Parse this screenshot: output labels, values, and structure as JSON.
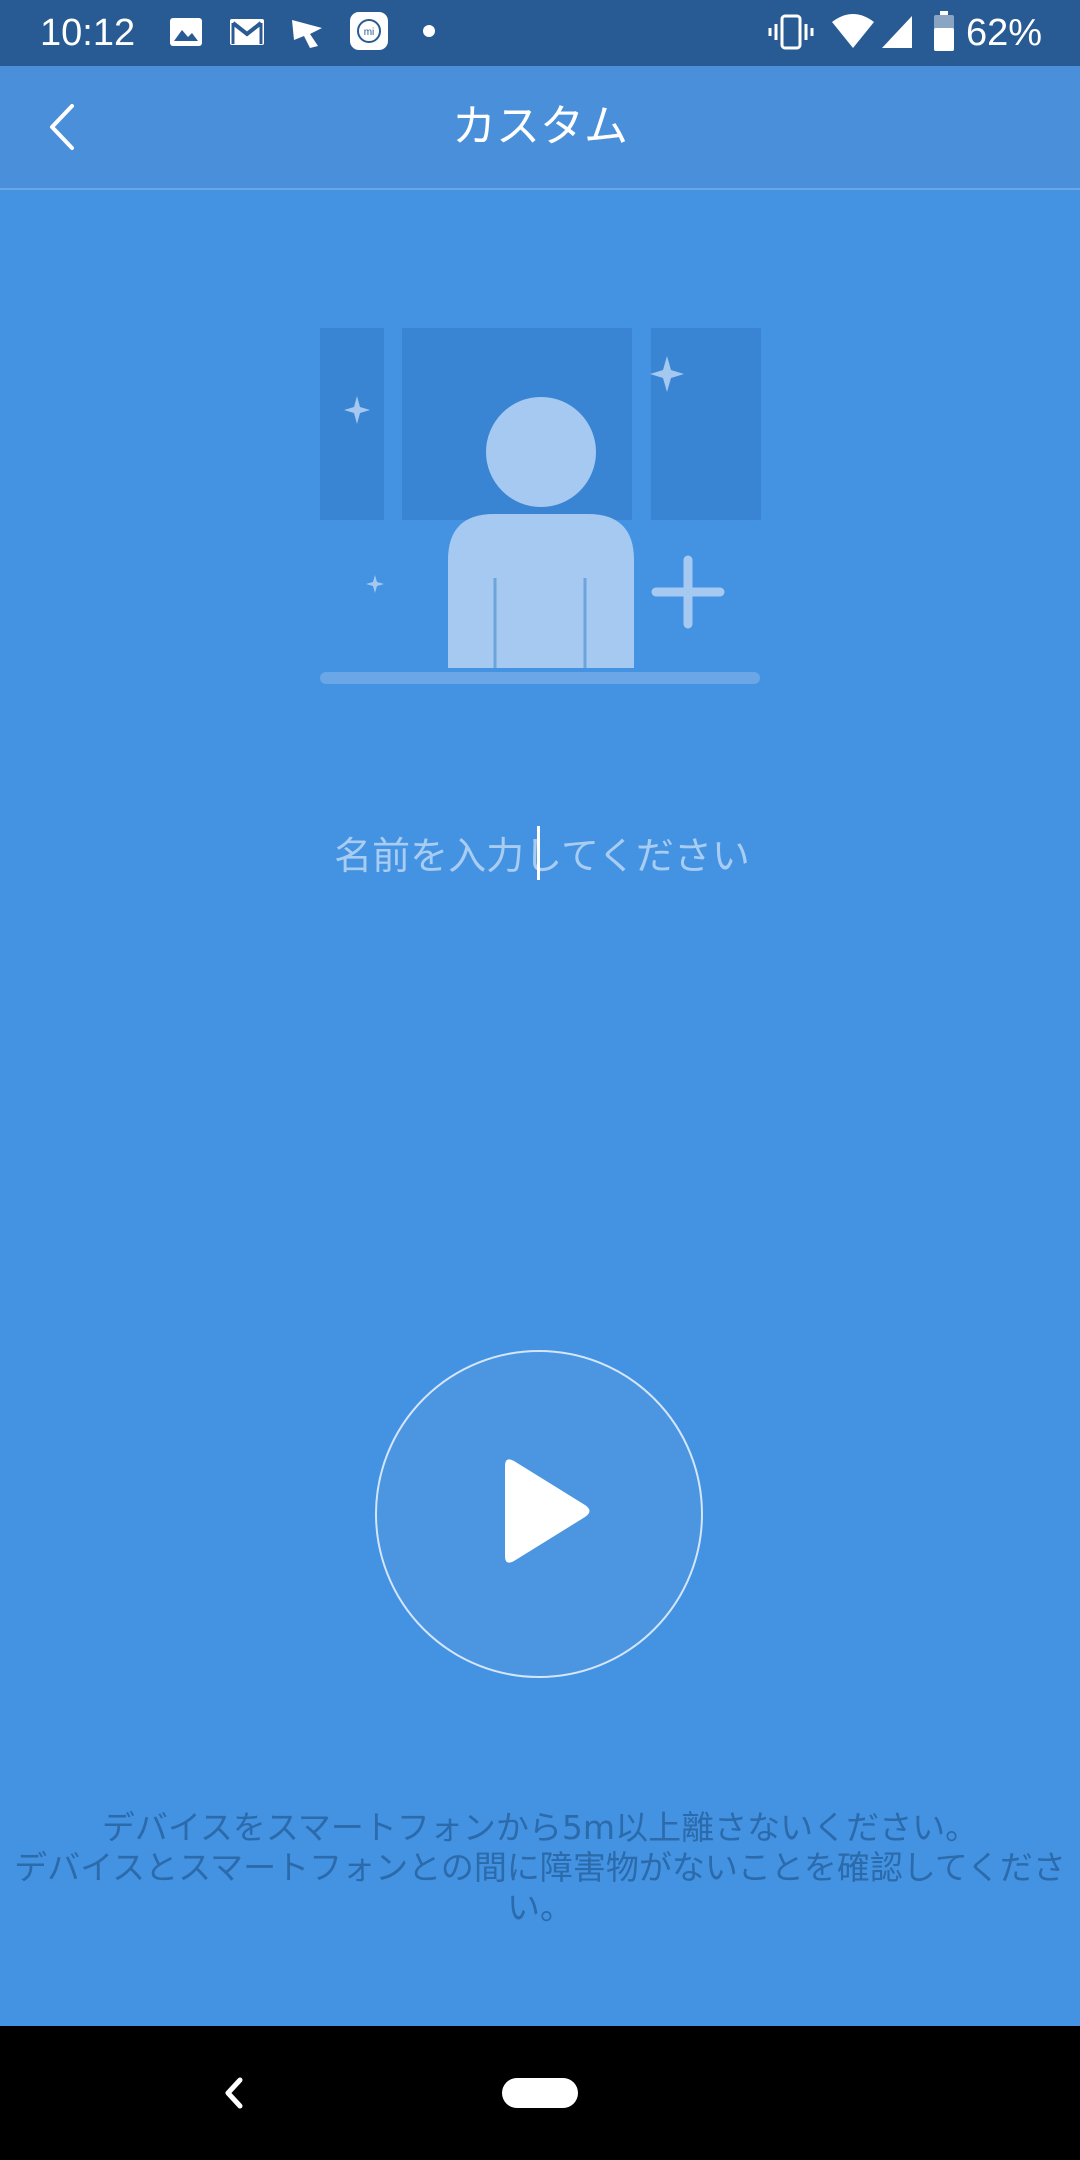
{
  "status_bar": {
    "time": "10:12",
    "battery": "62%",
    "icons": [
      "image-icon",
      "gmail-icon",
      "signal-app-icon",
      "mi-app-icon",
      "dot-icon",
      "vibrate-icon",
      "wifi-icon",
      "cell-signal-icon",
      "battery-icon"
    ]
  },
  "header": {
    "title": "カスタム"
  },
  "name_input": {
    "placeholder": "名前を入力してください",
    "value": ""
  },
  "instruction": {
    "line1": "デバイスをスマートフォンから5m以上離さないください。",
    "line2": "デバイスとスマートフォンとの間に障害物がないことを確認してください。"
  },
  "colors": {
    "background": "#4493e2",
    "status_bar": "#285b93",
    "header": "#4a8fd9",
    "placeholder": "#a9cdf2",
    "instruction_text": "#2b6aab"
  }
}
